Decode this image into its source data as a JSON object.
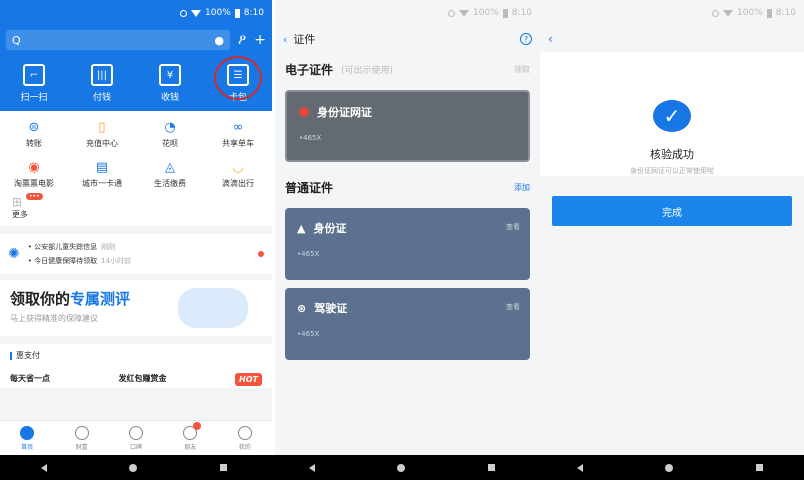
{
  "status": {
    "battery": "100%",
    "time": "8:10"
  },
  "screen1": {
    "search_icon": "search-icon",
    "quick_actions": [
      {
        "label": "扫一扫",
        "icon": "scan-icon"
      },
      {
        "label": "付钱",
        "icon": "barcode-icon"
      },
      {
        "label": "收钱",
        "icon": "receive-money-icon"
      },
      {
        "label": "卡包",
        "icon": "card-bag-icon"
      }
    ],
    "grid": [
      {
        "label": "转账",
        "icon": "transfer-icon"
      },
      {
        "label": "充值中心",
        "icon": "recharge-icon"
      },
      {
        "label": "花呗",
        "icon": "huabei-icon"
      },
      {
        "label": "共享单车",
        "icon": "bike-icon"
      },
      {
        "label": "淘票票电影",
        "icon": "movie-icon"
      },
      {
        "label": "城市一卡通",
        "icon": "city-card-icon"
      },
      {
        "label": "生活缴费",
        "icon": "bill-icon"
      },
      {
        "label": "滴滴出行",
        "icon": "didi-icon"
      }
    ],
    "more_label": "更多",
    "news": {
      "line1": "• 公安部儿童失踪信息",
      "line1_time": "刚刚",
      "line2": "• 今日健康保障待领取",
      "line2_time": "14小时前"
    },
    "banner": {
      "title_a": "领取你的",
      "title_b": "专属测评",
      "subtitle": "马上获得精准的保障建议"
    },
    "section_label": "惠支付",
    "promo1": "每天省一点",
    "promo2": "发红包赚赏金",
    "hot": "HOT",
    "tabs": [
      "首页",
      "财富",
      "口碑",
      "朋友",
      "我的"
    ]
  },
  "screen2": {
    "title": "证件",
    "electronic_heading": "电子证件",
    "electronic_hint": "(可出示使用)",
    "electronic_action": "领取",
    "electronic_card": {
      "title": "身份证网证",
      "number": "•465X"
    },
    "normal_heading": "普通证件",
    "normal_action": "添加",
    "cards": [
      {
        "title": "身份证",
        "number": "•465X",
        "action": "查看",
        "icon": "person-icon"
      },
      {
        "title": "驾驶证",
        "number": "•465X",
        "action": "查看",
        "icon": "steering-wheel-icon"
      }
    ]
  },
  "screen3": {
    "success_title": "核验成功",
    "success_subtitle": "身份证网证可以正常使用啦",
    "done_label": "完成"
  }
}
